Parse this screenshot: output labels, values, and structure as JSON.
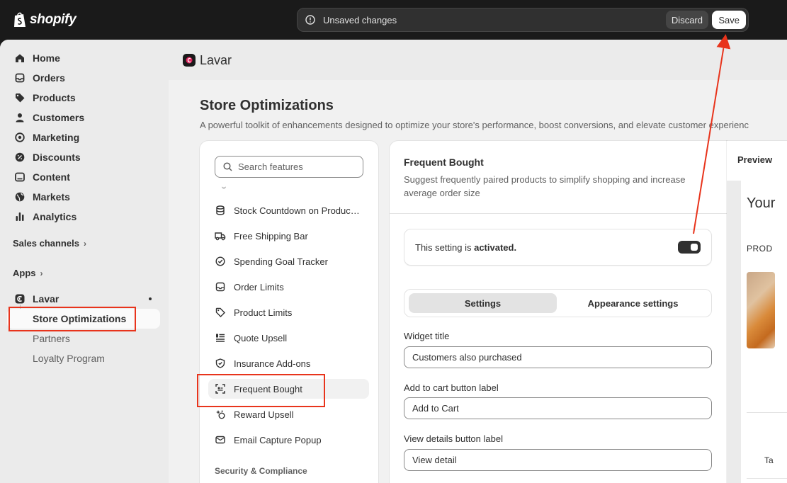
{
  "topbar": {
    "brand": "shopify",
    "unsaved_text": "Unsaved changes",
    "discard_label": "Discard",
    "save_label": "Save"
  },
  "sidebar": {
    "items": [
      {
        "label": "Home",
        "icon": "home-icon"
      },
      {
        "label": "Orders",
        "icon": "inbox-icon"
      },
      {
        "label": "Products",
        "icon": "tag-icon"
      },
      {
        "label": "Customers",
        "icon": "person-icon"
      },
      {
        "label": "Marketing",
        "icon": "target-icon"
      },
      {
        "label": "Discounts",
        "icon": "discount-icon"
      },
      {
        "label": "Content",
        "icon": "content-icon"
      },
      {
        "label": "Markets",
        "icon": "globe-icon"
      },
      {
        "label": "Analytics",
        "icon": "chart-icon"
      }
    ],
    "sales_channels": "Sales channels",
    "apps": "Apps",
    "app_name": "Lavar",
    "app_sub": [
      "Store Optimizations",
      "Partners",
      "Loyalty Program"
    ]
  },
  "app_header": {
    "name": "Lavar"
  },
  "page": {
    "title": "Store Optimizations",
    "subtitle": "A powerful toolkit of enhancements designed to optimize your store's performance, boost conversions, and elevate customer experienc"
  },
  "features": {
    "search_placeholder": "Search features",
    "items": [
      {
        "label": "Stock Countdown on Product Page",
        "icon": "database-icon"
      },
      {
        "label": "Free Shipping Bar",
        "icon": "truck-icon"
      },
      {
        "label": "Spending Goal Tracker",
        "icon": "check-circle-icon"
      },
      {
        "label": "Order Limits",
        "icon": "inbox-icon"
      },
      {
        "label": "Product Limits",
        "icon": "tag-icon"
      },
      {
        "label": "Quote Upsell",
        "icon": "list-icon"
      },
      {
        "label": "Insurance Add-ons",
        "icon": "shield-icon"
      },
      {
        "label": "Frequent Bought",
        "icon": "scan-icon"
      },
      {
        "label": "Reward Upsell",
        "icon": "sparkle-icon"
      },
      {
        "label": "Email Capture Popup",
        "icon": "mail-icon"
      }
    ],
    "group_title": "Security & Compliance"
  },
  "settings": {
    "title": "Frequent Bought",
    "description": "Suggest frequently paired products to simplify shopping and increase average order size",
    "activation_prefix": "This setting is ",
    "activation_state": "activated.",
    "toggle_on": true,
    "tabs": [
      "Settings",
      "Appearance settings"
    ],
    "fields": [
      {
        "label": "Widget title",
        "value": "Customers also purchased"
      },
      {
        "label": "Add to cart button label",
        "value": "Add to Cart"
      },
      {
        "label": "View details button label",
        "value": "View detail"
      }
    ]
  },
  "preview": {
    "tab": "Preview",
    "heading": "Your",
    "prod_label": "PROD",
    "ta_text": "Ta"
  },
  "colors": {
    "annotation": "#e8341c",
    "topbar": "#1a1a1a"
  }
}
